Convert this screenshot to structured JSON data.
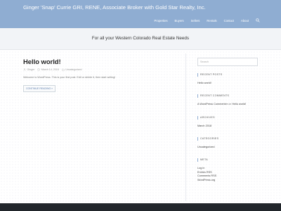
{
  "site": {
    "title": "Ginger 'Snap' Currie GRI, RENE, Associate Broker with Gold Star Realty, Inc.",
    "tagline": "For all your Western Colorado Real Estate Needs"
  },
  "nav": {
    "items": [
      {
        "label": "Properties"
      },
      {
        "label": "Buyers"
      },
      {
        "label": "Sellers"
      },
      {
        "label": "Rentals"
      },
      {
        "label": "Contact"
      },
      {
        "label": "About"
      }
    ],
    "search_icon": "search-icon"
  },
  "post": {
    "title": "Hello world!",
    "author": "Ginger",
    "date": "March 14, 2018",
    "category": "Uncategorized",
    "excerpt": "Welcome to WordPress. This is your first post. Edit or delete it, then start writing!",
    "read_more": "CONTINUE READING »"
  },
  "sidebar": {
    "search_placeholder": "Search",
    "recent_posts": {
      "title": "RECENT POSTS",
      "items": [
        "Hello world!"
      ]
    },
    "recent_comments": {
      "title": "RECENT COMMENTS",
      "commenter": "A WordPress Commenter",
      "on": "on",
      "post": "Hello world!"
    },
    "archives": {
      "title": "ARCHIVES",
      "items": [
        "March 2018"
      ]
    },
    "categories": {
      "title": "CATEGORIES",
      "items": [
        "Uncategorized"
      ]
    },
    "meta": {
      "title": "META",
      "items": [
        "Log in",
        "Entries RSS",
        "Comments RSS",
        "WordPress.org"
      ]
    }
  },
  "colors": {
    "header_bg": "#8fadd2",
    "footer_bg": "#22262b",
    "accent": "#5f7fae"
  }
}
